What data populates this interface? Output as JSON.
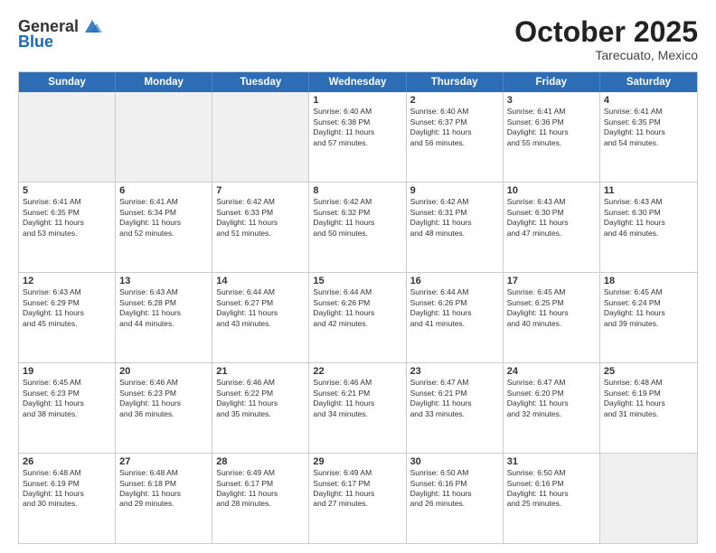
{
  "header": {
    "logo": {
      "general": "General",
      "blue": "Blue"
    },
    "title": "October 2025",
    "subtitle": "Tarecuato, Mexico"
  },
  "days": [
    "Sunday",
    "Monday",
    "Tuesday",
    "Wednesday",
    "Thursday",
    "Friday",
    "Saturday"
  ],
  "weeks": [
    [
      {
        "day": "",
        "info": ""
      },
      {
        "day": "",
        "info": ""
      },
      {
        "day": "",
        "info": ""
      },
      {
        "day": "1",
        "info": "Sunrise: 6:40 AM\nSunset: 6:38 PM\nDaylight: 11 hours\nand 57 minutes."
      },
      {
        "day": "2",
        "info": "Sunrise: 6:40 AM\nSunset: 6:37 PM\nDaylight: 11 hours\nand 56 minutes."
      },
      {
        "day": "3",
        "info": "Sunrise: 6:41 AM\nSunset: 6:36 PM\nDaylight: 11 hours\nand 55 minutes."
      },
      {
        "day": "4",
        "info": "Sunrise: 6:41 AM\nSunset: 6:35 PM\nDaylight: 11 hours\nand 54 minutes."
      }
    ],
    [
      {
        "day": "5",
        "info": "Sunrise: 6:41 AM\nSunset: 6:35 PM\nDaylight: 11 hours\nand 53 minutes."
      },
      {
        "day": "6",
        "info": "Sunrise: 6:41 AM\nSunset: 6:34 PM\nDaylight: 11 hours\nand 52 minutes."
      },
      {
        "day": "7",
        "info": "Sunrise: 6:42 AM\nSunset: 6:33 PM\nDaylight: 11 hours\nand 51 minutes."
      },
      {
        "day": "8",
        "info": "Sunrise: 6:42 AM\nSunset: 6:32 PM\nDaylight: 11 hours\nand 50 minutes."
      },
      {
        "day": "9",
        "info": "Sunrise: 6:42 AM\nSunset: 6:31 PM\nDaylight: 11 hours\nand 48 minutes."
      },
      {
        "day": "10",
        "info": "Sunrise: 6:43 AM\nSunset: 6:30 PM\nDaylight: 11 hours\nand 47 minutes."
      },
      {
        "day": "11",
        "info": "Sunrise: 6:43 AM\nSunset: 6:30 PM\nDaylight: 11 hours\nand 46 minutes."
      }
    ],
    [
      {
        "day": "12",
        "info": "Sunrise: 6:43 AM\nSunset: 6:29 PM\nDaylight: 11 hours\nand 45 minutes."
      },
      {
        "day": "13",
        "info": "Sunrise: 6:43 AM\nSunset: 6:28 PM\nDaylight: 11 hours\nand 44 minutes."
      },
      {
        "day": "14",
        "info": "Sunrise: 6:44 AM\nSunset: 6:27 PM\nDaylight: 11 hours\nand 43 minutes."
      },
      {
        "day": "15",
        "info": "Sunrise: 6:44 AM\nSunset: 6:26 PM\nDaylight: 11 hours\nand 42 minutes."
      },
      {
        "day": "16",
        "info": "Sunrise: 6:44 AM\nSunset: 6:26 PM\nDaylight: 11 hours\nand 41 minutes."
      },
      {
        "day": "17",
        "info": "Sunrise: 6:45 AM\nSunset: 6:25 PM\nDaylight: 11 hours\nand 40 minutes."
      },
      {
        "day": "18",
        "info": "Sunrise: 6:45 AM\nSunset: 6:24 PM\nDaylight: 11 hours\nand 39 minutes."
      }
    ],
    [
      {
        "day": "19",
        "info": "Sunrise: 6:45 AM\nSunset: 6:23 PM\nDaylight: 11 hours\nand 38 minutes."
      },
      {
        "day": "20",
        "info": "Sunrise: 6:46 AM\nSunset: 6:23 PM\nDaylight: 11 hours\nand 36 minutes."
      },
      {
        "day": "21",
        "info": "Sunrise: 6:46 AM\nSunset: 6:22 PM\nDaylight: 11 hours\nand 35 minutes."
      },
      {
        "day": "22",
        "info": "Sunrise: 6:46 AM\nSunset: 6:21 PM\nDaylight: 11 hours\nand 34 minutes."
      },
      {
        "day": "23",
        "info": "Sunrise: 6:47 AM\nSunset: 6:21 PM\nDaylight: 11 hours\nand 33 minutes."
      },
      {
        "day": "24",
        "info": "Sunrise: 6:47 AM\nSunset: 6:20 PM\nDaylight: 11 hours\nand 32 minutes."
      },
      {
        "day": "25",
        "info": "Sunrise: 6:48 AM\nSunset: 6:19 PM\nDaylight: 11 hours\nand 31 minutes."
      }
    ],
    [
      {
        "day": "26",
        "info": "Sunrise: 6:48 AM\nSunset: 6:19 PM\nDaylight: 11 hours\nand 30 minutes."
      },
      {
        "day": "27",
        "info": "Sunrise: 6:48 AM\nSunset: 6:18 PM\nDaylight: 11 hours\nand 29 minutes."
      },
      {
        "day": "28",
        "info": "Sunrise: 6:49 AM\nSunset: 6:17 PM\nDaylight: 11 hours\nand 28 minutes."
      },
      {
        "day": "29",
        "info": "Sunrise: 6:49 AM\nSunset: 6:17 PM\nDaylight: 11 hours\nand 27 minutes."
      },
      {
        "day": "30",
        "info": "Sunrise: 6:50 AM\nSunset: 6:16 PM\nDaylight: 11 hours\nand 26 minutes."
      },
      {
        "day": "31",
        "info": "Sunrise: 6:50 AM\nSunset: 6:16 PM\nDaylight: 11 hours\nand 25 minutes."
      },
      {
        "day": "",
        "info": ""
      }
    ]
  ]
}
